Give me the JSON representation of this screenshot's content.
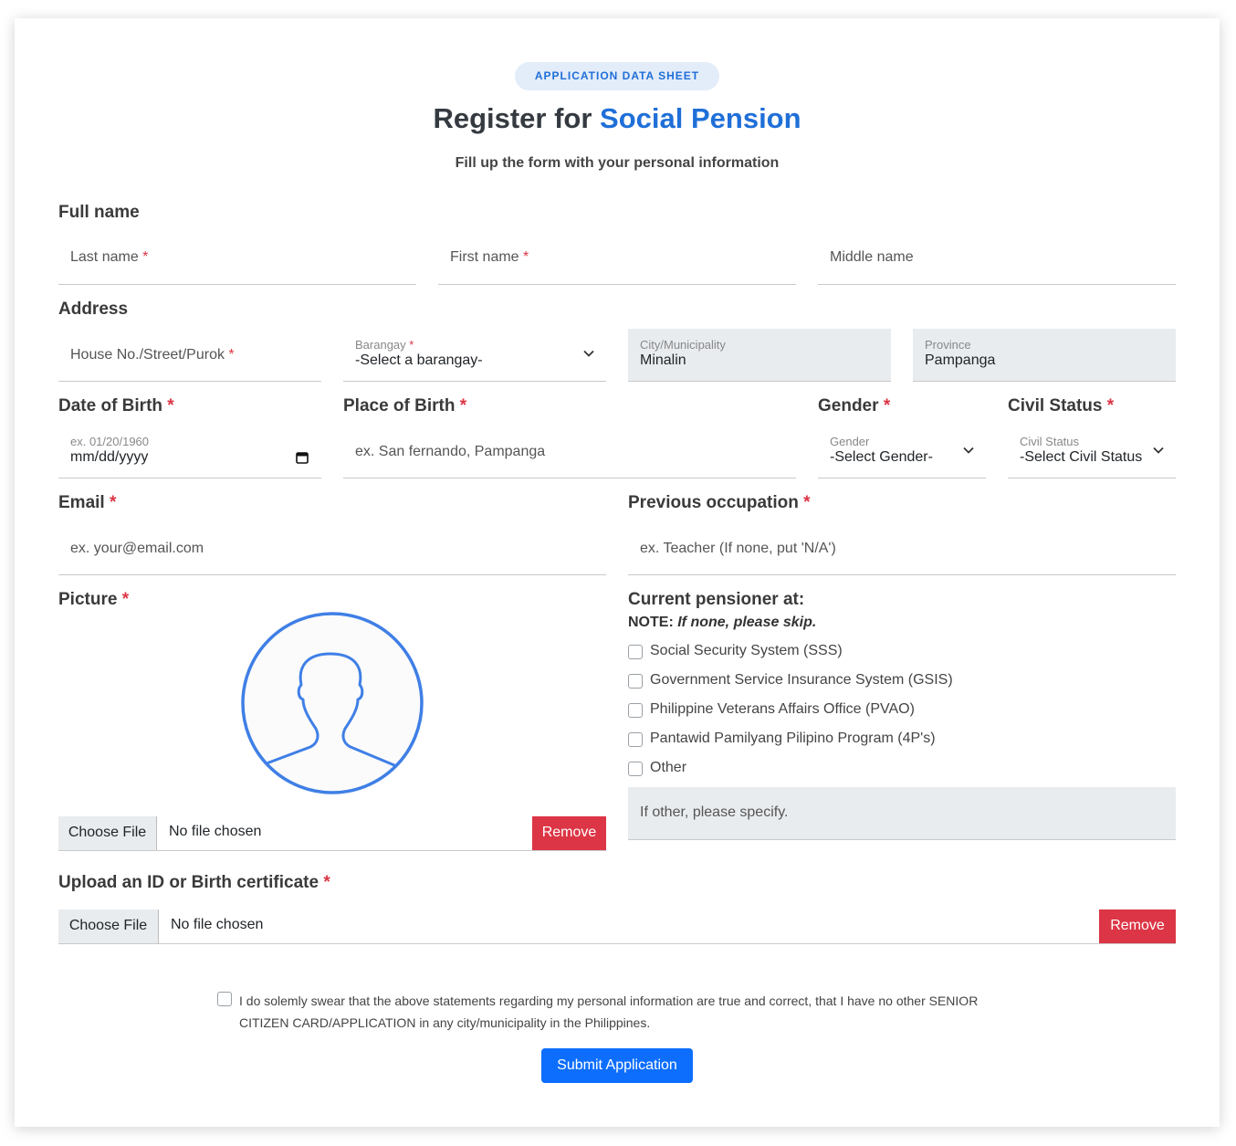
{
  "header": {
    "badge": "APPLICATION DATA SHEET",
    "title_prefix": "Register for",
    "title_accent": "Social Pension",
    "subtitle": "Fill up the form with your personal information"
  },
  "full_name": {
    "label": "Full name",
    "last_name_placeholder": "Last name",
    "first_name_placeholder": "First name",
    "middle_name_placeholder": "Middle name"
  },
  "address": {
    "label": "Address",
    "house_placeholder": "House No./Street/Purok",
    "barangay_label": "Barangay",
    "barangay_value": "-Select a barangay-",
    "city_label": "City/Municipality",
    "city_value": "Minalin",
    "province_label": "Province",
    "province_value": "Pampanga"
  },
  "birth": {
    "dob_label": "Date of Birth",
    "dob_hint": "ex. 01/20/1960",
    "dob_value": "mm/dd/yyyy",
    "pob_label": "Place of Birth",
    "pob_placeholder": "ex. San fernando, Pampanga"
  },
  "gender": {
    "label": "Gender",
    "small_label": "Gender",
    "value": "-Select Gender-"
  },
  "civil_status": {
    "label": "Civil Status",
    "small_label": "Civil Status",
    "value": "-Select Civil Status-"
  },
  "email": {
    "label": "Email",
    "placeholder": "ex. your@email.com"
  },
  "occupation": {
    "label": "Previous occupation",
    "placeholder": "ex. Teacher (If none, put 'N/A')"
  },
  "picture": {
    "label": "Picture",
    "choose_label": "Choose File",
    "file_status": "No file chosen",
    "remove_label": "Remove"
  },
  "pensioner": {
    "label": "Current pensioner at:",
    "note_prefix": "NOTE:",
    "note_text": "If none, please skip.",
    "options": [
      "Social Security System (SSS)",
      "Government Service Insurance System (GSIS)",
      "Philippine Veterans Affairs Office (PVAO)",
      "Pantawid Pamilyang Pilipino Program (4P's)",
      "Other"
    ],
    "other_placeholder": "If other, please specify."
  },
  "upload_id": {
    "label": "Upload an ID or Birth certificate",
    "choose_label": "Choose File",
    "file_status": "No file chosen",
    "remove_label": "Remove"
  },
  "oath": {
    "line1": "I do solemly swear that the above statements regarding my personal information are true and correct, that I have no other SENIOR",
    "line2": "CITIZEN CARD/APPLICATION in any city/municipality in the Philippines."
  },
  "submit_label": "Submit Application",
  "required_mark": "*",
  "colors": {
    "accent": "#1f6fd8",
    "required": "#dc3545",
    "submit": "#0d6efd",
    "remove": "#dc3545"
  }
}
